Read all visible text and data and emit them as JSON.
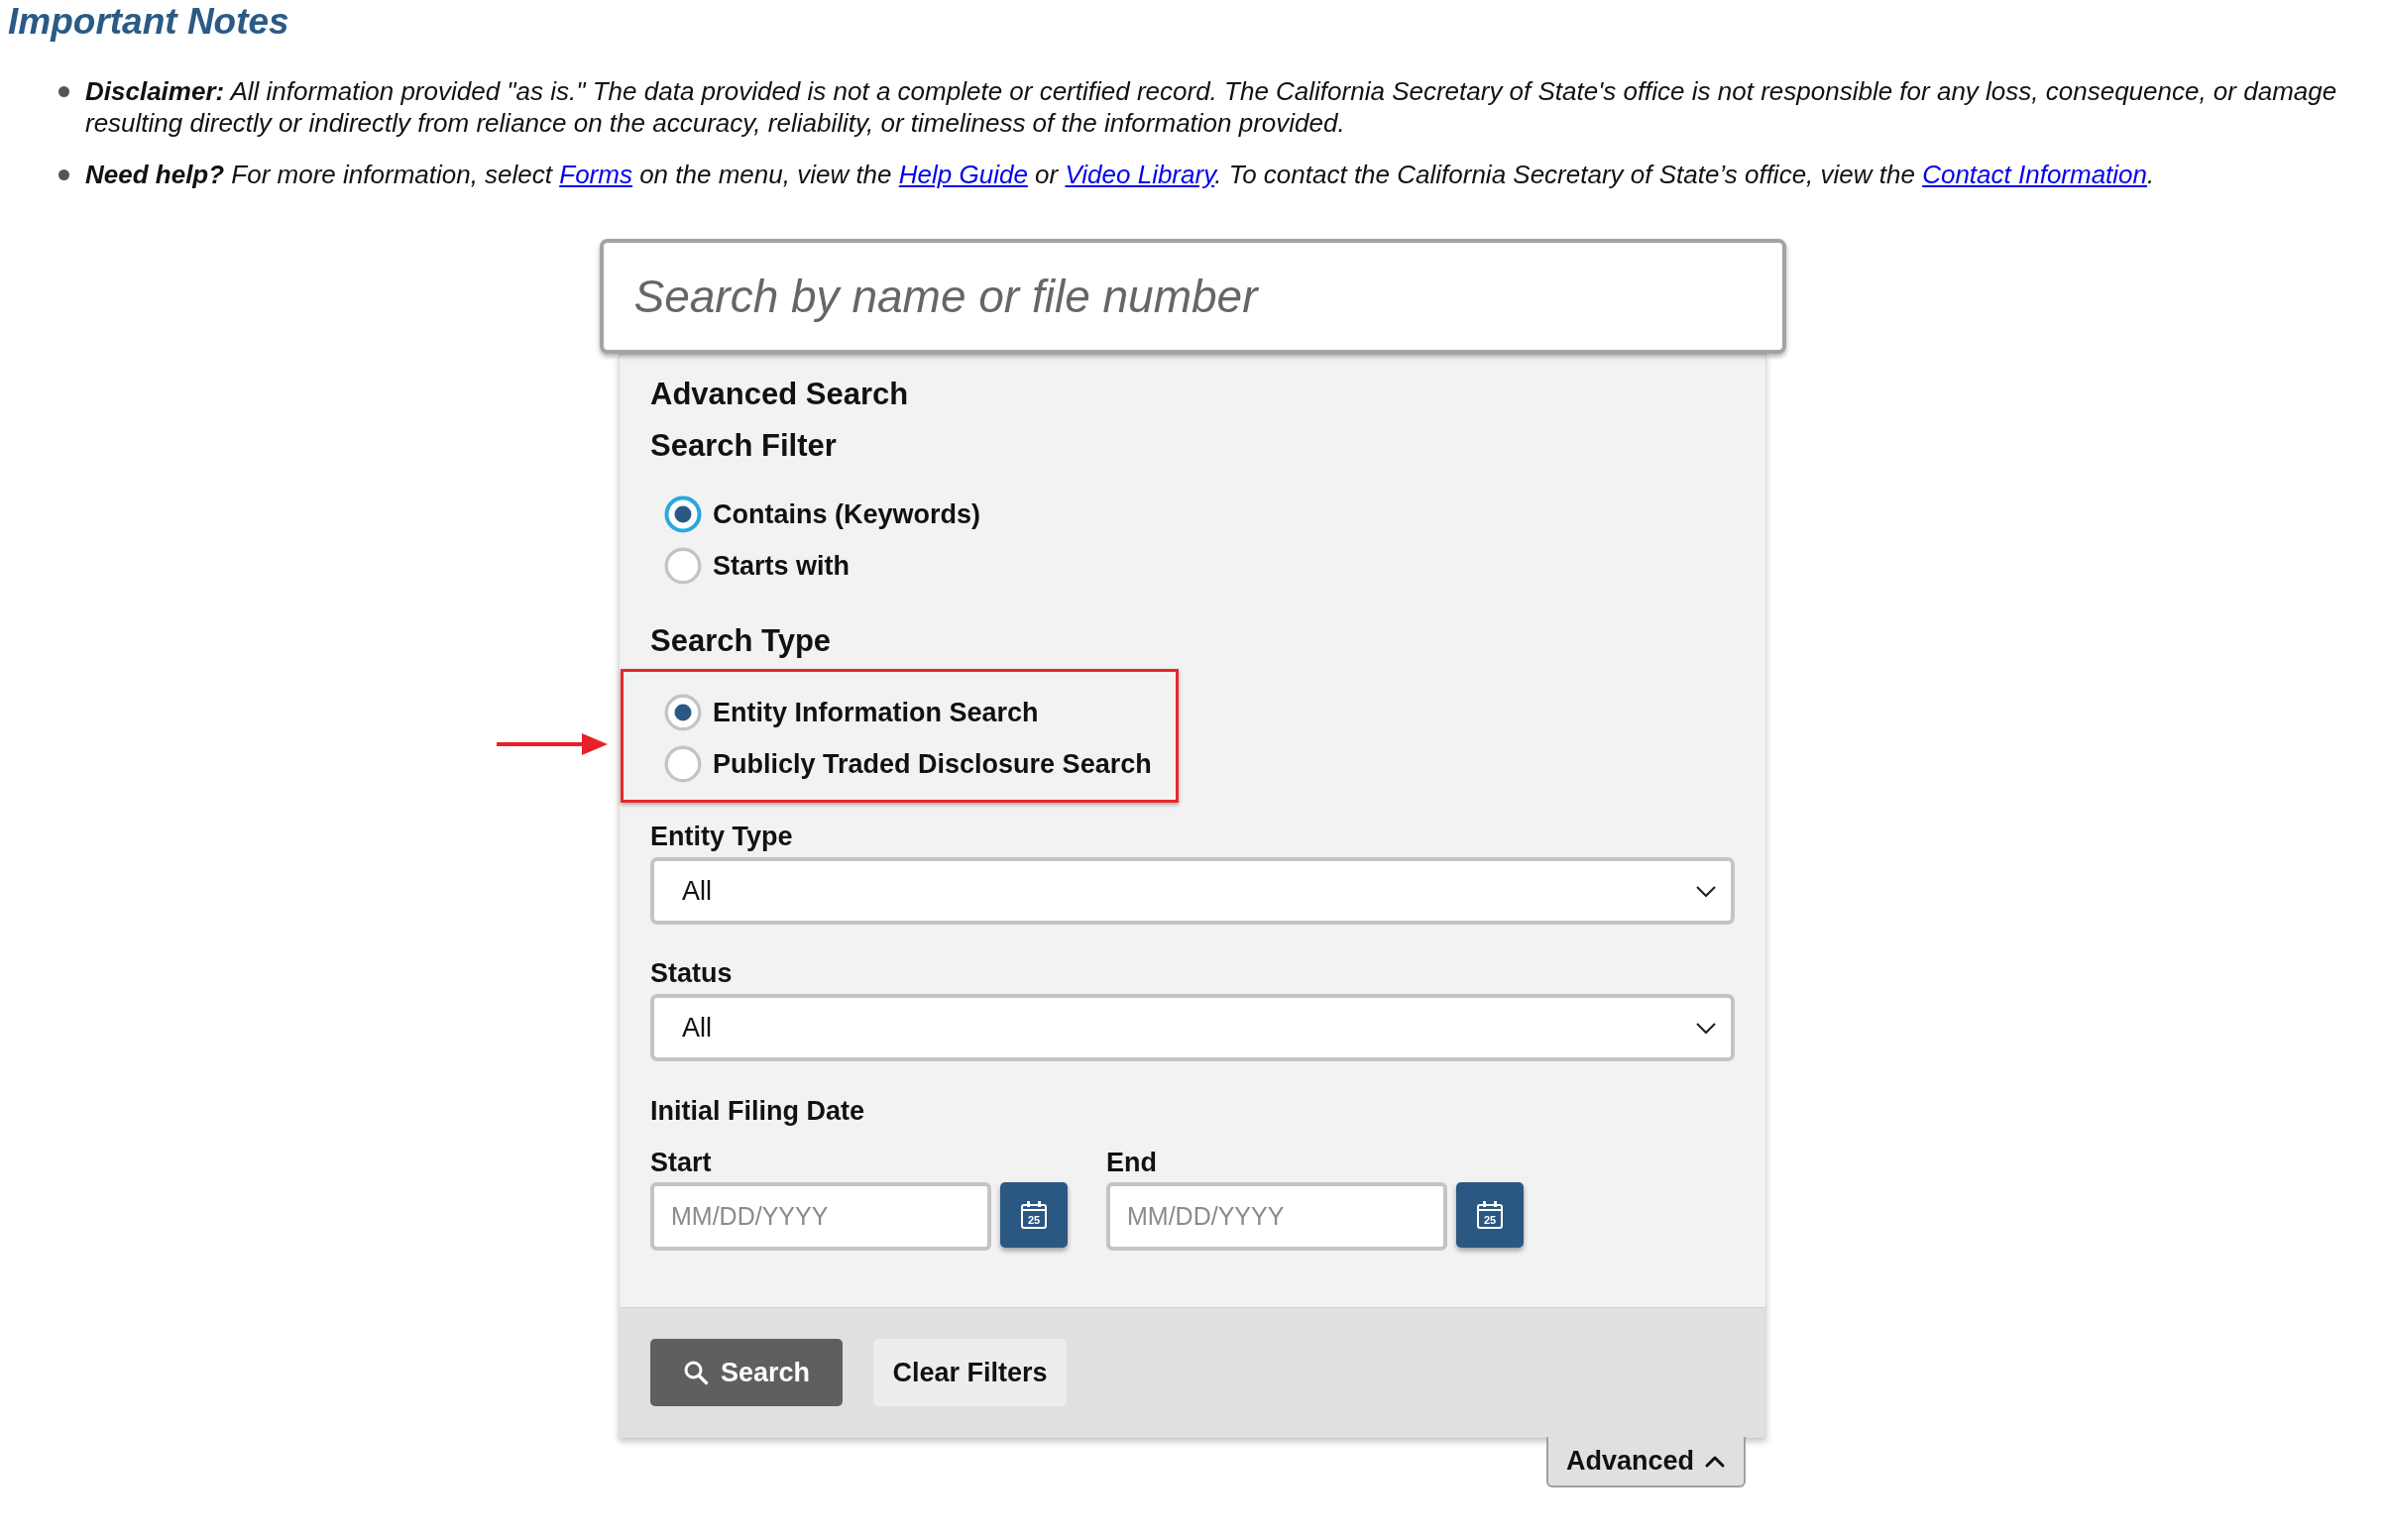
{
  "notes": {
    "title": "Important Notes",
    "items": [
      {
        "parts": [
          {
            "kind": "text",
            "text": "**Disclaimer:** All information provided \"as is.\" The data provided is not a complete or certified record. The California Secretary of State's office is not responsible for any loss, consequence, or damage resulting directly or indirectly from reliance on the accuracy, reliability, or timeliness of the information provided."
          }
        ]
      },
      {
        "parts": [
          {
            "kind": "text",
            "text": "**Need help?** For more information, select "
          },
          {
            "kind": "link",
            "text": "Forms"
          },
          {
            "kind": "text",
            "text": " on the menu, view the "
          },
          {
            "kind": "link",
            "text": "Help Guide"
          },
          {
            "kind": "text",
            "text": " or "
          },
          {
            "kind": "link",
            "text": "Video Library"
          },
          {
            "kind": "text",
            "text": ". To contact the California Secretary of State’s office, view the "
          },
          {
            "kind": "link",
            "text": "Contact Information"
          },
          {
            "kind": "text",
            "text": "."
          }
        ]
      }
    ]
  },
  "search_box": {
    "placeholder": "Search by name or file number"
  },
  "advanced_search": {
    "title": "Advanced Search",
    "search_filter": {
      "label": "Search Filter",
      "options": [
        {
          "label": "Contains (Keywords)",
          "selected": true,
          "focused": true
        },
        {
          "label": "Starts with",
          "selected": false,
          "focused": false
        }
      ]
    },
    "search_type": {
      "label": "Search Type",
      "highlighted": true,
      "options": [
        {
          "label": "Entity Information Search",
          "selected": true
        },
        {
          "label": "Publicly Traded Disclosure Search",
          "selected": false
        }
      ]
    },
    "entity_type": {
      "label": "Entity Type",
      "value": "All"
    },
    "status": {
      "label": "Status",
      "value": "All"
    },
    "initial_filing_date": {
      "label": "Initial Filing Date",
      "start": {
        "label": "Start",
        "placeholder": "MM/DD/YYYY",
        "calendar_day": "25"
      },
      "end": {
        "label": "End",
        "placeholder": "MM/DD/YYYY",
        "calendar_day": "25"
      }
    },
    "buttons": [
      {
        "kind": "primary",
        "label": "Search"
      },
      {
        "kind": "secondary",
        "label": "Clear Filters"
      }
    ]
  },
  "advanced_toggle": {
    "label": "Advanced",
    "expanded": true
  }
}
